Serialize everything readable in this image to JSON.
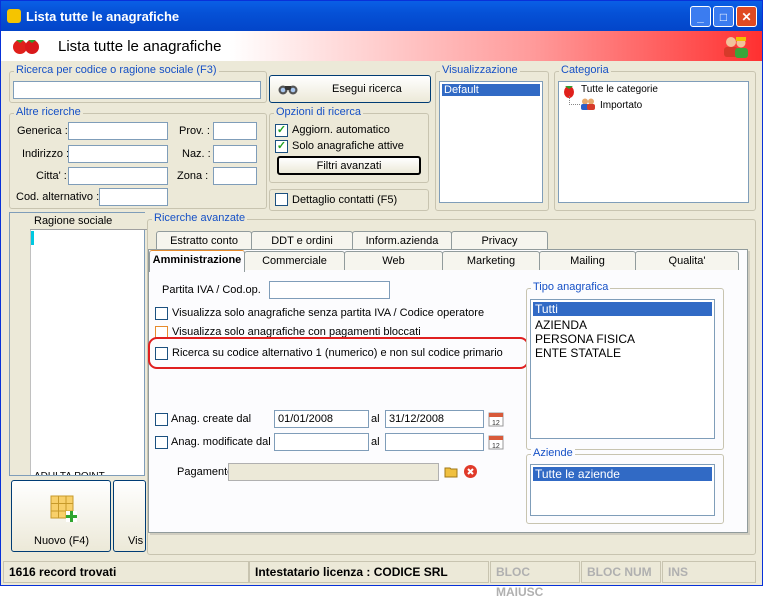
{
  "window": {
    "title": "Lista tutte le anagrafiche",
    "header_title": "Lista tutte le anagrafiche"
  },
  "search": {
    "group_label": "Ricerca per codice o ragione sociale (F3)",
    "value": "",
    "button_label": "Esegui ricerca"
  },
  "altre": {
    "group_label": "Altre ricerche",
    "generica": "Generica :",
    "indirizzo": "Indirizzo :",
    "citta": "Citta' :",
    "cod_alt": "Cod. alternativo :",
    "prov": "Prov. :",
    "naz": "Naz. :",
    "zona": "Zona :"
  },
  "opzioni": {
    "group_label": "Opzioni di ricerca",
    "aggiorn": "Aggiorn. automatico",
    "solo_attive": "Solo anagrafiche attive",
    "filtri": "Filtri avanzati",
    "dettaglio": "Dettaglio contatti (F5)"
  },
  "visualizzazione": {
    "group_label": "Visualizzazione",
    "items": [
      "Default"
    ]
  },
  "categoria": {
    "group_label": "Categoria",
    "root": "Tutte le categorie",
    "child": "Importato"
  },
  "grid": {
    "column": "Ragione sociale",
    "bottom_text": "ADULTA POINT"
  },
  "buttons": {
    "nuovo": "Nuovo (F4)",
    "vis": "Vis"
  },
  "avanzate": {
    "label": "Ricerche avanzate",
    "tabs_row1": [
      "Estratto conto",
      "DDT e ordini",
      "Inform.azienda",
      "Privacy"
    ],
    "tabs_row2": [
      "Amministrazione",
      "Commerciale",
      "Web",
      "Marketing",
      "Mailing",
      "Qualita'"
    ],
    "partita_label": "Partita IVA / Cod.op.",
    "chk1": "Visualizza solo anagrafiche senza partita IVA / Codice operatore",
    "chk2": "Visualizza solo anagrafiche con pagamenti bloccati",
    "chk3": "Ricerca su codice alternativo 1 (numerico)  e non sul codice primario",
    "anag_create": "Anag. create dal",
    "anag_mod": "Anag. modificate dal",
    "al": "al",
    "date_from": "01/01/2008",
    "date_to": "31/12/2008",
    "pagamento": "Pagamento :",
    "tipo_label": "Tipo anagrafica",
    "tipo_items": [
      "Tutti",
      "AZIENDA",
      "PERSONA FISICA",
      "ENTE STATALE"
    ],
    "aziende_label": "Aziende",
    "aziende_items": [
      "Tutte le aziende"
    ]
  },
  "status": {
    "records": "1616 record trovati",
    "license": "Intestatario licenza : CODICE SRL",
    "caps": "BLOC MAIUSC",
    "num": "BLOC NUM",
    "ins": "INS"
  }
}
